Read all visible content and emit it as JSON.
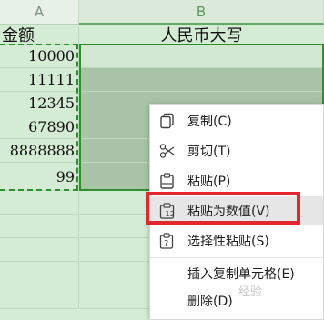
{
  "columns": {
    "a": "A",
    "b": "B"
  },
  "rows": [
    {
      "a": "金额",
      "b": "人民币大写"
    },
    {
      "a": "10000",
      "b": ""
    },
    {
      "a": "11111",
      "b": ""
    },
    {
      "a": "12345",
      "b": ""
    },
    {
      "a": "67890",
      "b": ""
    },
    {
      "a": "8888888",
      "b": ""
    },
    {
      "a": "99",
      "b": ""
    },
    {
      "a": "",
      "b": ""
    },
    {
      "a": "",
      "b": ""
    },
    {
      "a": "",
      "b": ""
    },
    {
      "a": "",
      "b": ""
    },
    {
      "a": "",
      "b": ""
    }
  ],
  "context_menu": {
    "items": [
      {
        "label": "复制(C)",
        "icon": "copy-icon"
      },
      {
        "label": "剪切(T)",
        "icon": "scissors-icon"
      },
      {
        "label": "粘贴(P)",
        "icon": "paste-icon"
      },
      {
        "label": "粘贴为数值(V)",
        "icon": "paste-values-icon"
      },
      {
        "label": "选择性粘贴(S)",
        "icon": "paste-special-icon"
      },
      {
        "label": "插入复制单元格(E)",
        "icon": ""
      },
      {
        "label": "删除(D)",
        "icon": ""
      }
    ],
    "highlight_color": "#e0282e"
  },
  "watermark": "经验"
}
